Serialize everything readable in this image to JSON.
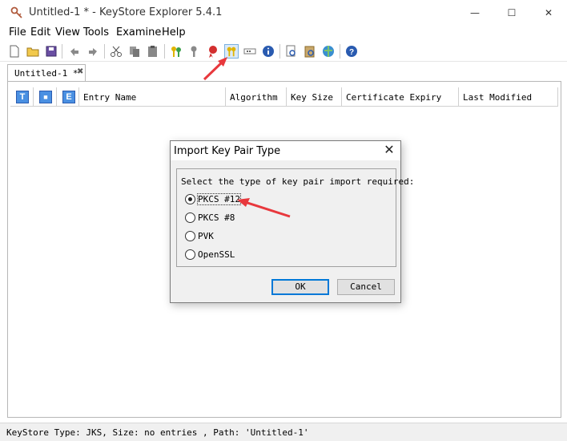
{
  "window": {
    "title": "Untitled-1 * - KeyStore Explorer 5.4.1",
    "controls": {
      "minimize": "—",
      "maximize": "☐",
      "close": "✕"
    }
  },
  "menu": [
    "File",
    "Edit",
    "View",
    "Tools",
    "Examine",
    "Help"
  ],
  "toolbar": {
    "icons": [
      "new-icon",
      "open-icon",
      "save-icon",
      "undo-icon",
      "redo-icon",
      "cut-icon",
      "copy-icon",
      "paste-icon",
      "generate-key-pair-icon",
      "generate-secret-key-icon",
      "import-trusted-certificate-icon",
      "import-key-pair-icon",
      "set-password-icon",
      "properties-icon",
      "examine-file-icon",
      "examine-clipboard-icon",
      "examine-ssl-icon",
      "help-icon"
    ]
  },
  "tab": {
    "label": "Untitled-1 *",
    "close": "✖"
  },
  "table": {
    "icon_columns": [
      "T",
      "🔒",
      "E"
    ],
    "columns": [
      "Entry Name",
      "Algorithm",
      "Key Size",
      "Certificate Expiry",
      "Last Modified"
    ]
  },
  "status": "KeyStore Type: JKS, Size: no entries , Path: 'Untitled-1'",
  "dialog": {
    "title": "Import Key Pair Type",
    "close": "✕",
    "prompt": "Select the type of key pair import required:",
    "options": [
      {
        "label": "PKCS #12",
        "selected": true
      },
      {
        "label": "PKCS #8",
        "selected": false
      },
      {
        "label": "PVK",
        "selected": false
      },
      {
        "label": "OpenSSL",
        "selected": false
      }
    ],
    "ok": "OK",
    "cancel": "Cancel"
  },
  "colors": {
    "annotation_arrow": "#e8383d",
    "accent": "#0078d7"
  }
}
